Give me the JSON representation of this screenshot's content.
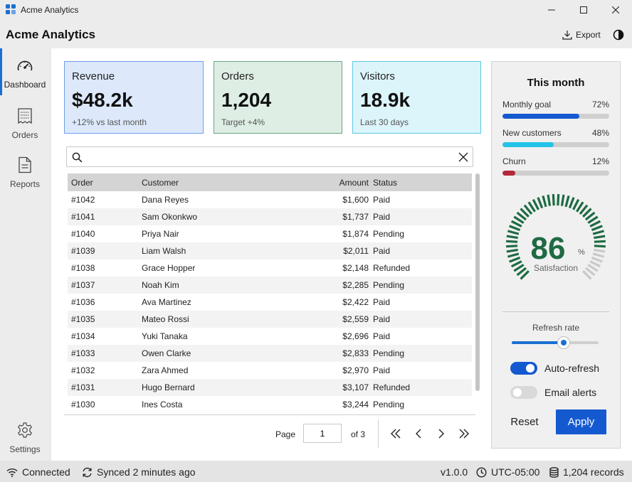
{
  "window": {
    "title": "Acme Analytics"
  },
  "header": {
    "title": "Acme Analytics",
    "export_label": "Export"
  },
  "sidebar": {
    "items": [
      {
        "label": "Dashboard",
        "icon": "gauge-icon",
        "active": true
      },
      {
        "label": "Orders",
        "icon": "receipt-icon"
      },
      {
        "label": "Reports",
        "icon": "document-icon"
      }
    ],
    "settings_label": "Settings"
  },
  "kpis": [
    {
      "label": "Revenue",
      "value": "$48.2k",
      "sub": "+12% vs last month",
      "bg": "#dde9fb",
      "border": "#6e9de8"
    },
    {
      "label": "Orders",
      "value": "1,204",
      "sub": "Target +4%",
      "bg": "#deeee4",
      "border": "#6aa483"
    },
    {
      "label": "Visitors",
      "value": "18.9k",
      "sub": "Last 30 days",
      "bg": "#dcf5fb",
      "border": "#5ec8e4"
    }
  ],
  "search": {
    "value": "",
    "placeholder": ""
  },
  "table": {
    "columns": [
      "Order",
      "Customer",
      "Amount",
      "Status"
    ],
    "rows": [
      [
        "#1042",
        "Dana Reyes",
        "$1,600",
        "Paid"
      ],
      [
        "#1041",
        "Sam Okonkwo",
        "$1,737",
        "Paid"
      ],
      [
        "#1040",
        "Priya Nair",
        "$1,874",
        "Pending"
      ],
      [
        "#1039",
        "Liam Walsh",
        "$2,011",
        "Paid"
      ],
      [
        "#1038",
        "Grace Hopper",
        "$2,148",
        "Refunded"
      ],
      [
        "#1037",
        "Noah Kim",
        "$2,285",
        "Pending"
      ],
      [
        "#1036",
        "Ava Martinez",
        "$2,422",
        "Paid"
      ],
      [
        "#1035",
        "Mateo Rossi",
        "$2,559",
        "Paid"
      ],
      [
        "#1034",
        "Yuki Tanaka",
        "$2,696",
        "Paid"
      ],
      [
        "#1033",
        "Owen Clarke",
        "$2,833",
        "Pending"
      ],
      [
        "#1032",
        "Zara Ahmed",
        "$2,970",
        "Paid"
      ],
      [
        "#1031",
        "Hugo Bernard",
        "$3,107",
        "Refunded"
      ],
      [
        "#1030",
        "Ines Costa",
        "$3,244",
        "Pending"
      ]
    ]
  },
  "pagination": {
    "page_label": "Page",
    "page_value": "1",
    "of_label": "of 3"
  },
  "panel": {
    "title": "This month",
    "metrics": [
      {
        "label": "Monthly goal",
        "value": "72%",
        "fraction": 0.72,
        "color": "#1559d0"
      },
      {
        "label": "New customers",
        "value": "48%",
        "fraction": 0.48,
        "color": "#22c3e6"
      },
      {
        "label": "Churn",
        "value": "12%",
        "fraction": 0.12,
        "color": "#b3283a"
      }
    ],
    "gauge": {
      "value": "86",
      "unit": "%",
      "label": "Satisfaction",
      "fraction": 0.86,
      "color": "#1e6b43",
      "track": "#c9c9c9"
    },
    "refresh_label": "Refresh rate",
    "refresh_fraction": 0.6,
    "toggles": [
      {
        "label": "Auto-refresh",
        "on": true
      },
      {
        "label": "Email alerts",
        "on": false
      }
    ],
    "reset_label": "Reset",
    "apply_label": "Apply"
  },
  "status": {
    "connection": "Connected",
    "sync": "Synced 2 minutes ago",
    "version": "v1.0.0",
    "timezone": "UTC-05:00",
    "records": "1,204 records"
  }
}
